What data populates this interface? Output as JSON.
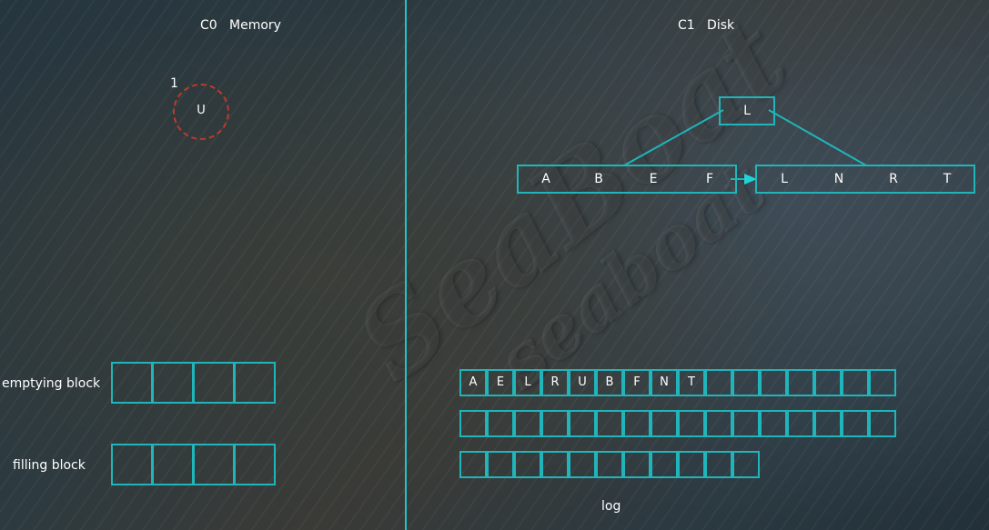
{
  "headers": {
    "left": "C0   Memory",
    "right": "C1   Disk"
  },
  "memory_node": {
    "label": "U",
    "index": "1"
  },
  "tree": {
    "root": "L",
    "leaf_left": [
      "A",
      "B",
      "E",
      "F"
    ],
    "leaf_right": [
      "L",
      "N",
      "R",
      "T"
    ]
  },
  "blocks": {
    "emptying_label": "emptying block",
    "filling_label": "filling block"
  },
  "log": {
    "row1": [
      "A",
      "E",
      "L",
      "R",
      "U",
      "B",
      "F",
      "N",
      "T",
      "",
      "",
      "",
      "",
      "",
      "",
      ""
    ],
    "row2": [
      "",
      "",
      "",
      "",
      "",
      "",
      "",
      "",
      "",
      "",
      "",
      "",
      "",
      "",
      "",
      ""
    ],
    "row3": [
      "",
      "",
      "",
      "",
      "",
      "",
      "",
      "",
      "",
      "",
      ""
    ],
    "label": "log"
  },
  "colors": {
    "accent": "#1fb5ba",
    "divider": "#1fc4c9",
    "circle": "#c0392b"
  }
}
